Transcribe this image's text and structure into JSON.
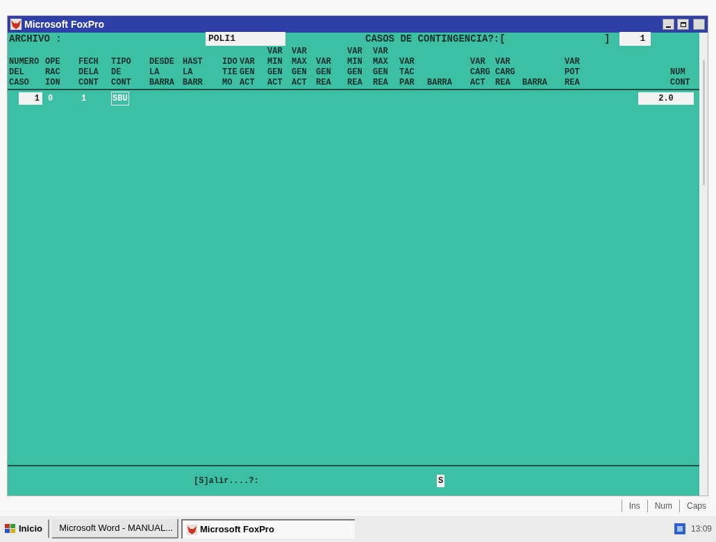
{
  "window": {
    "title": "Microsoft FoxPro"
  },
  "top_line": {
    "archivo_label": "ARCHIVO :",
    "archivo_value": "POLI1",
    "casos_label": "CASOS DE CONTINGENCIA?:[",
    "casos_close": "]",
    "casos_value": "1"
  },
  "table": {
    "columns": [
      {
        "lines": [
          "NUMERO",
          "DEL",
          "CASO"
        ]
      },
      {
        "lines": [
          "OPE",
          "RAC",
          "ION"
        ]
      },
      {
        "lines": [
          "FECH",
          "DELA",
          "CONT"
        ]
      },
      {
        "lines": [
          "TIPO",
          "DE",
          "CONT"
        ]
      },
      {
        "lines": [
          "DESDE",
          "LA",
          "BARRA"
        ]
      },
      {
        "lines": [
          "HAST",
          "LA",
          "BARR"
        ]
      },
      {
        "lines": [
          "IDO",
          "TIE",
          "MO"
        ]
      },
      {
        "lines": [
          "VAR",
          "GEN",
          "ACT"
        ]
      },
      {
        "lines": [
          "VAR",
          "MIN",
          "GEN",
          "ACT"
        ]
      },
      {
        "lines": [
          "VAR",
          "MAX",
          "GEN",
          "ACT"
        ]
      },
      {
        "lines": [
          "VAR",
          "GEN",
          "REA"
        ]
      },
      {
        "lines": [
          "VAR",
          "MIN",
          "GEN",
          "REA"
        ]
      },
      {
        "lines": [
          "VAR",
          "MAX",
          "GEN",
          "REA"
        ]
      },
      {
        "lines": [
          "VAR",
          "TAC",
          "PAR"
        ]
      },
      {
        "lines": [
          "BARRA"
        ]
      },
      {
        "lines": [
          "VAR",
          "CARG",
          "ACT"
        ]
      },
      {
        "lines": [
          "VAR",
          "CARG",
          "REA"
        ]
      },
      {
        "lines": [
          "BARRA"
        ]
      },
      {
        "lines": [
          "VAR",
          "POT",
          "REA"
        ]
      },
      {
        "lines": [
          "NUM",
          "CONT"
        ]
      }
    ],
    "rows": [
      {
        "cells": [
          "1",
          "0",
          "1",
          "SBU"
        ],
        "last_cell": "2.0"
      }
    ]
  },
  "prompt": {
    "label": "[S]alir....?:",
    "value": "S"
  },
  "status_bar": [
    "Ins",
    "Num",
    "Caps"
  ],
  "taskbar": {
    "start": "Inicio",
    "tasks": [
      {
        "label": "Microsoft Word - MANUAL...",
        "kind": "word",
        "selected": false
      },
      {
        "label": "Microsoft FoxPro",
        "kind": "foxpro",
        "selected": true
      }
    ],
    "clock": "13:09"
  }
}
